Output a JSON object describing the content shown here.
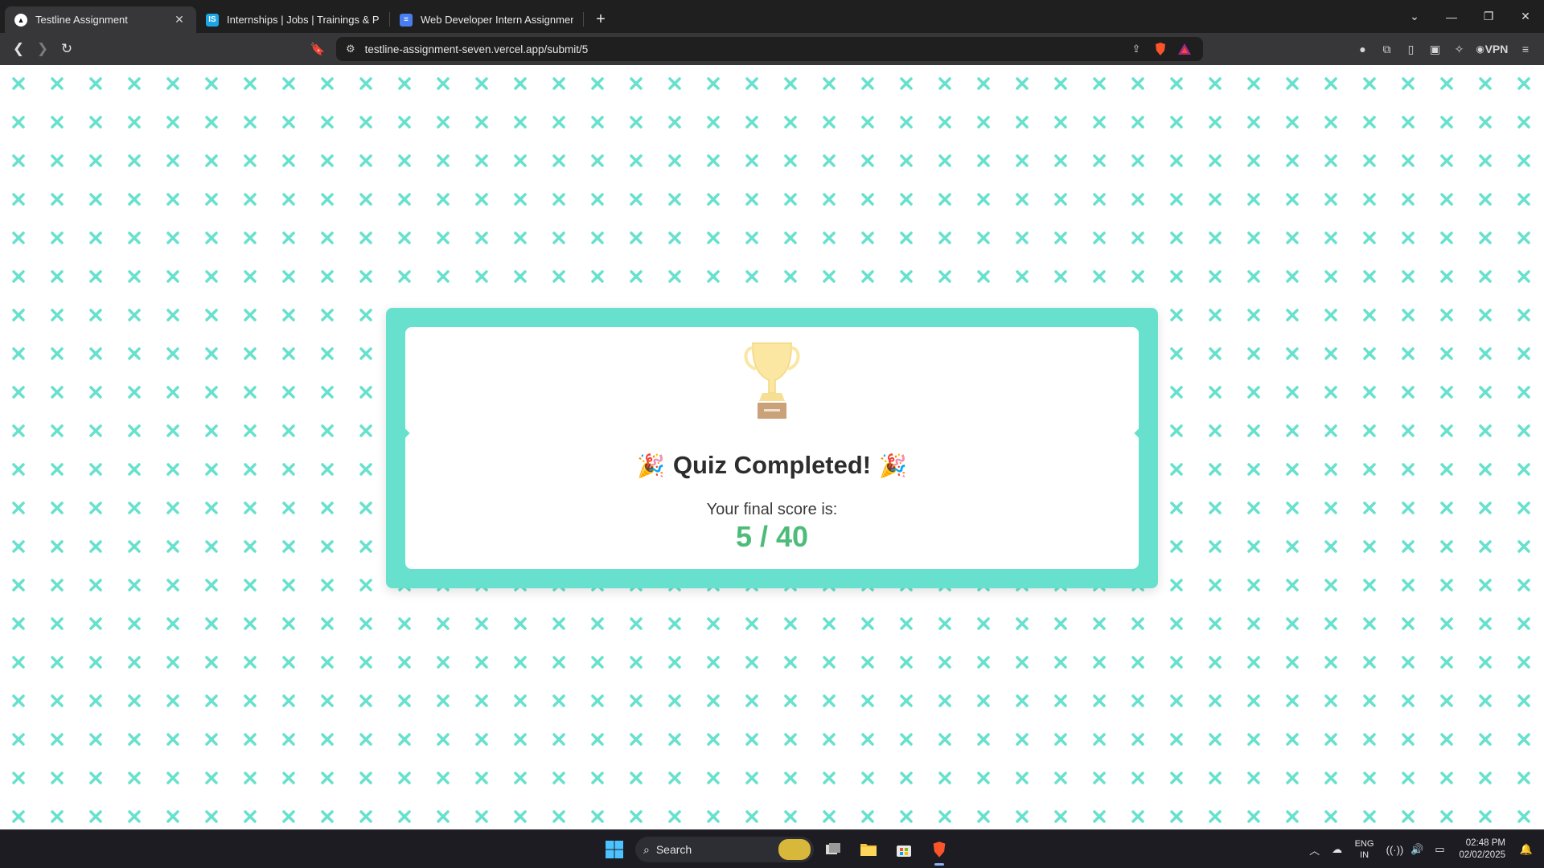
{
  "browser": {
    "tabs": [
      {
        "title": "Testline Assignment",
        "active": true,
        "favicon": "testline-favicon"
      },
      {
        "title": "Internships | Jobs | Trainings & Place",
        "active": false,
        "favicon": "internshala-favicon"
      },
      {
        "title": "Web Developer Intern Assignment",
        "active": false,
        "favicon": "docs-favicon"
      }
    ],
    "url": "testline-assignment-seven.vercel.app/submit/5",
    "vpn_label": "VPN"
  },
  "result": {
    "title": "Quiz Completed!",
    "party_emoji": "🎉",
    "score_label": "Your final score is:",
    "score": "5 / 40",
    "score_value": 5,
    "score_total": 40
  },
  "taskbar": {
    "search_placeholder": "Search",
    "lang_line1": "ENG",
    "lang_line2": "IN",
    "time": "02:48 PM",
    "date": "02/02/2025"
  },
  "colors": {
    "accent": "#67e1cd",
    "score": "#4dbb7a",
    "pattern": "#67e1cd"
  }
}
